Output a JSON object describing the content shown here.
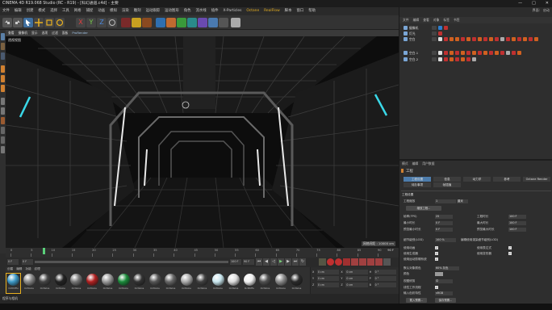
{
  "window": {
    "title": "CINEMA 4D R19.068 Studio (RC - R19) - [科幻通道.c4d] - 主要",
    "controls": [
      "—",
      "□",
      "✕"
    ]
  },
  "menubar": [
    "文件",
    "编辑",
    "创建",
    "模式",
    "选择",
    "工具",
    "网格",
    "捕捉",
    "动画",
    "模拟",
    "渲染",
    "雕刻",
    "运动跟踪",
    "运动图形",
    "角色",
    "流水线",
    "插件",
    "X-Particles",
    "Octane",
    "RealFlow",
    "脚本",
    "窗口",
    "帮助"
  ],
  "toolbar_icons": [
    "undo-icon",
    "redo-icon",
    "select-icon",
    "move-icon",
    "scale-icon",
    "rotate-icon",
    "x-axis-icon",
    "y-axis-icon",
    "z-axis-icon",
    "world-coord-icon",
    "render-view-icon",
    "render-pic-icon",
    "render-settings-icon",
    "cube-icon",
    "pen-icon",
    "subdivision-icon",
    "cloner-icon",
    "deformer-icon",
    "floor-icon",
    "camera-icon",
    "light-icon"
  ],
  "toolbar_xyz": [
    "X",
    "Y",
    "Z"
  ],
  "viewport": {
    "menu": [
      "查看",
      "摄像机",
      "显示",
      "选项",
      "过滤",
      "面板",
      "ProRender"
    ],
    "label": "透视视图",
    "grid_space": "网格间距 : 10000 cm"
  },
  "timeline": {
    "ticks": [
      "0",
      "5",
      "10",
      "15",
      "20",
      "25",
      "30",
      "35",
      "40",
      "45",
      "50",
      "55",
      "60",
      "65",
      "70",
      "75",
      "80",
      "85",
      "90"
    ],
    "frame_end": "90 F",
    "current": "0 F",
    "start": "0 F",
    "end_field": "100 F",
    "end_field2": "90 F",
    "playhead_frame": 8
  },
  "materials": {
    "menu": [
      "创建",
      "编辑",
      "功能",
      "纹理"
    ],
    "items": [
      {
        "label": "OctDiffu",
        "color": "#3d9ac8"
      },
      {
        "label": "OctGlos",
        "color": "#888888"
      },
      {
        "label": "OctGlos",
        "color": "#444444"
      },
      {
        "label": "OctGlos",
        "color": "#222222"
      },
      {
        "label": "OctGlos",
        "color": "#777777"
      },
      {
        "label": "OctGlos",
        "color": "#b02020"
      },
      {
        "label": "OctGlos",
        "color": "#999999"
      },
      {
        "label": "OctGlos",
        "color": "#1a8a3a"
      },
      {
        "label": "OctGlos",
        "color": "#333333"
      },
      {
        "label": "OctGlos",
        "color": "#555555"
      },
      {
        "label": "OctGlos",
        "color": "#666666"
      },
      {
        "label": "OctGlos",
        "color": "#aaaaaa"
      },
      {
        "label": "OctGlos",
        "color": "#404040"
      },
      {
        "label": "OctGlos",
        "color": "#c8e6ee"
      },
      {
        "label": "OctGlos",
        "color": "#dddddd"
      },
      {
        "label": "OctDiffu",
        "color": "#f0f0f0"
      },
      {
        "label": "OctGlos",
        "color": "#505050"
      },
      {
        "label": "OctGlos",
        "color": "#8a8a8a"
      },
      {
        "label": "OctGlos",
        "color": "#2a2a2a"
      }
    ]
  },
  "coords": {
    "rows": [
      [
        "X",
        "0 cm",
        "X",
        "0 cm",
        "H",
        "0 °"
      ],
      [
        "Y",
        "0 cm",
        "Y",
        "0 cm",
        "P",
        "0 °"
      ],
      [
        "Z",
        "0 cm",
        "Z",
        "0 cm",
        "B",
        "0 °"
      ]
    ],
    "mode": "对象(相对)",
    "size": "绝对尺寸",
    "apply": "应用"
  },
  "status": "程序与相机",
  "right_panel": {
    "tabs": [
      "界面:",
      "启动"
    ],
    "obj_menu": [
      "文件",
      "编辑",
      "查看",
      "对象",
      "标签",
      "书签"
    ],
    "objects": [
      {
        "name": "摄像机",
        "tags": [
          "#2d7fd0",
          "#c03030"
        ]
      },
      {
        "name": "灯光",
        "tags": [
          "#c03030"
        ]
      },
      {
        "name": "空白",
        "tags": [
          "#dddddd",
          "#c03030",
          "#d06020",
          "#d06020",
          "#c03030",
          "#d06020",
          "#c03030",
          "#d06020",
          "#c03030",
          "#d06020",
          "#c03030",
          "#aaaaaa",
          "#c03030",
          "#d06020",
          "#c03030",
          "#d06020",
          "#c03030",
          "#d06020"
        ]
      },
      {
        "name": "空白.1",
        "tags": [
          "#dddddd",
          "#c03030",
          "#d06020",
          "#c03030",
          "#d06020",
          "#c03030",
          "#d06020",
          "#c03030",
          "#d06020",
          "#c03030",
          "#d06020",
          "#c03030",
          "#aaaaaa",
          "#c03030",
          "#d06020"
        ]
      },
      {
        "name": "空白.2",
        "tags": [
          "#dddddd",
          "#c03030",
          "#d06020",
          "#c03030",
          "#d06020",
          "#c03030",
          "#aaaaaa"
        ]
      }
    ],
    "attr_menu": [
      "模式",
      "编辑",
      "用户数据"
    ],
    "attr_title": "工程",
    "attr_tabs_row1": [
      "工程设置",
      "信息",
      "动力学",
      "参考",
      "Octane Render"
    ],
    "attr_tabs_row2": [
      "待办事项",
      "帧插值"
    ],
    "section": "工程设置",
    "scale_label": "工程缩放",
    "scale_value": "1",
    "scale_unit": "厘米",
    "scale_btn": "缩放工程...",
    "fields_left": [
      {
        "label": "帧率(FPS)",
        "value": "25"
      },
      {
        "label": "最小时长",
        "value": "0 F"
      },
      {
        "label": "预览最小时长",
        "value": "0 F"
      }
    ],
    "fields_right": [
      {
        "label": "工程时长",
        "value": "100 F"
      },
      {
        "label": "最大时长",
        "value": "100 F"
      },
      {
        "label": "预览最大时长",
        "value": "100 F"
      }
    ],
    "lod_label": "细节级别(LOD)",
    "lod_value": "100 %",
    "lod_right": "编辑使用渲染细节级别(LOD)",
    "checks": [
      {
        "label": "使用动画",
        "value": "✓",
        "right": "使用表达式",
        "rvalue": "✓"
      },
      {
        "label": "使用生成器",
        "value": "✓",
        "right": "使用变形器",
        "rvalue": "✓"
      },
      {
        "label": "使用运动剪辑系统",
        "value": "✓",
        "right": "",
        "rvalue": ""
      }
    ],
    "default_color_label": "默认对象颜色",
    "default_color_value": "60% 灰色",
    "color_label": "颜色",
    "clip_label": "视图修剪",
    "clip_value": "中",
    "linear_label": "线性工作流程",
    "linear_value": "✓",
    "input_color_label": "输入色彩特性",
    "input_color_value": "sRGB",
    "btn_load": "载入预置...",
    "btn_save": "保存预置..."
  }
}
